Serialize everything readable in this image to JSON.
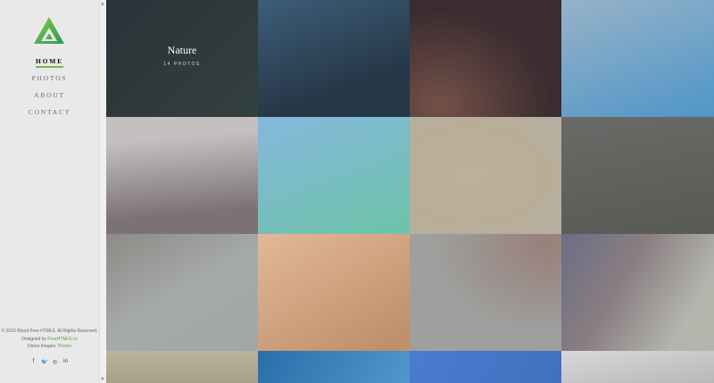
{
  "nav": {
    "items": [
      "HOME",
      "PHOTOS",
      "ABOUT",
      "CONTACT"
    ],
    "active": "HOME"
  },
  "footer": {
    "copyright": "© 2016 Blend Free HTML5. All Rights Reserved.",
    "designed_prefix": "Designed by",
    "designed_link": "FreeHTML5.co",
    "images_prefix": "Demo Images:",
    "images_link": "Pexels"
  },
  "social": [
    {
      "icon": "facebook-icon",
      "glyph": "f"
    },
    {
      "icon": "twitter-icon",
      "glyph": "🐦"
    },
    {
      "icon": "instagram-icon",
      "glyph": "◎"
    },
    {
      "icon": "linkedin-icon",
      "glyph": "in"
    }
  ],
  "featured": {
    "title": "Nature",
    "count": "14 PHOTOS"
  },
  "colors": {
    "accent": "#7ab84a",
    "sidebar_bg": "#e9e9e9",
    "logo_dark": "#3a9a4a",
    "logo_light": "#8ac84a"
  }
}
